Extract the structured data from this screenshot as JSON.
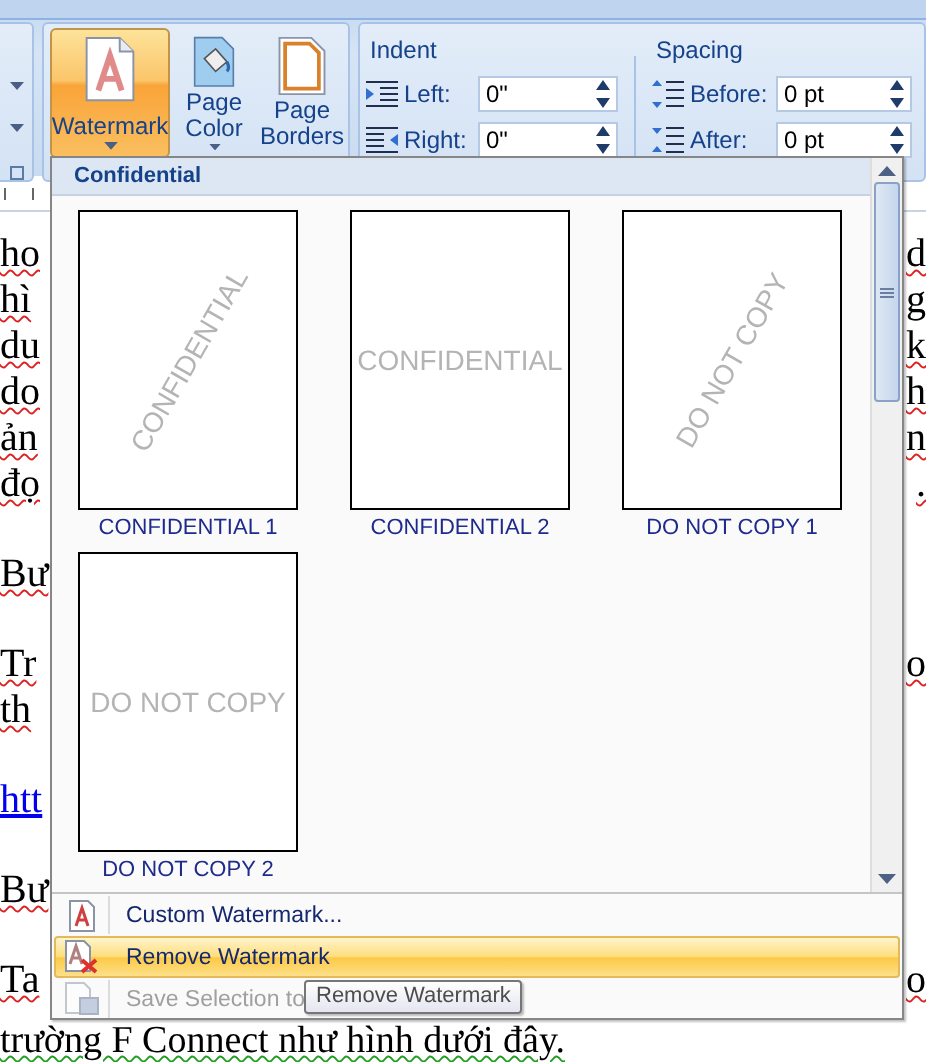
{
  "ribbon": {
    "page_background": [
      {
        "label": "Watermark",
        "kind": "watermark",
        "selected": true,
        "dropdown": true
      },
      {
        "label": "Page Color",
        "kind": "page-color",
        "selected": false,
        "dropdown": true
      },
      {
        "label": "Page Borders",
        "kind": "page-borders",
        "selected": false,
        "dropdown": false
      }
    ],
    "indent": {
      "title": "Indent",
      "fields": [
        {
          "label": "Left:",
          "value": "0\"",
          "kind": "indent-left"
        },
        {
          "label": "Right:",
          "value": "0\"",
          "kind": "indent-right"
        }
      ]
    },
    "spacing": {
      "title": "Spacing",
      "fields": [
        {
          "label": "Before:",
          "value": "0 pt",
          "kind": "space-before"
        },
        {
          "label": "After:",
          "value": "0 pt",
          "kind": "space-after"
        }
      ]
    }
  },
  "document": {
    "paragraphs": [
      {
        "lines": [
          {
            "left": "ho",
            "right": "d"
          },
          {
            "left": "hì",
            "right": "g"
          },
          {
            "left": "du",
            "right": "k"
          },
          {
            "left": "do",
            "right": "h"
          },
          {
            "left": "ản",
            "right": "n"
          },
          {
            "left": "đọ",
            "right": "."
          }
        ]
      },
      {
        "lines": [
          {
            "left": "Bư"
          }
        ]
      },
      {
        "lines": [
          {
            "left": "Tr",
            "right": "o"
          },
          {
            "left": "th"
          }
        ]
      },
      {
        "lines": [
          {
            "left": "htt",
            "kind": "link"
          }
        ]
      },
      {
        "lines": [
          {
            "left": "Bư"
          }
        ]
      },
      {
        "lines": [
          {
            "left": "Ta",
            "right": "o"
          },
          {
            "left": "trường F Connect như hình dưới đây.",
            "kind": "full"
          }
        ]
      }
    ]
  },
  "watermark_menu": {
    "section": "Confidential",
    "gallery": [
      {
        "label": "CONFIDENTIAL 1",
        "watermark": "CONFIDENTIAL",
        "diagonal": true
      },
      {
        "label": "CONFIDENTIAL 2",
        "watermark": "CONFIDENTIAL",
        "diagonal": false
      },
      {
        "label": "DO NOT COPY 1",
        "watermark": "DO NOT COPY",
        "diagonal": true
      },
      {
        "label": "DO NOT COPY 2",
        "watermark": "DO NOT COPY",
        "diagonal": false
      }
    ],
    "items": [
      {
        "label": "Custom Watermark...",
        "kind": "custom",
        "selected": false,
        "disabled": false
      },
      {
        "label": "Remove Watermark",
        "kind": "remove",
        "selected": true,
        "disabled": false
      },
      {
        "label": "Save Selection to",
        "kind": "save",
        "selected": false,
        "disabled": true
      }
    ],
    "tooltip": "Remove Watermark"
  }
}
